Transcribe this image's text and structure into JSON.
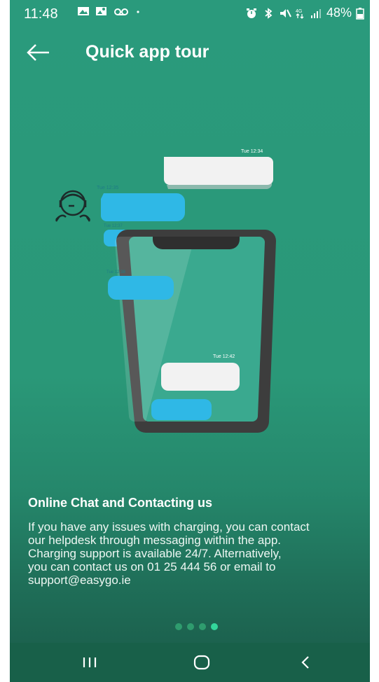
{
  "status_bar": {
    "time": "11:48",
    "battery_percent": "48%",
    "signal_label": "4G"
  },
  "app_bar": {
    "title": "Quick app tour"
  },
  "illustration": {
    "timestamps": [
      "Tue 12:34",
      "Tue 12:35",
      "Tue 12:37",
      "Tue 12:38",
      "Tue 12:42"
    ]
  },
  "content": {
    "title": "Online Chat and Contacting us",
    "body_lines": [
      "If you have any issues with charging, you can contact",
      "our helpdesk through messaging within the app.",
      "Charging support is available 24/7. Alternatively,",
      "you can contact us on 01 25 444 56 or email to",
      "support@easygo.ie"
    ]
  },
  "pagination": {
    "total": 4,
    "active_index": 3
  },
  "colors": {
    "background": "#2a9a7c",
    "nav_bar": "#186049",
    "chat_bubble_blue": "#2fb8e6",
    "chat_bubble_white": "#f2f2f2",
    "active_dot": "#33d69b"
  }
}
